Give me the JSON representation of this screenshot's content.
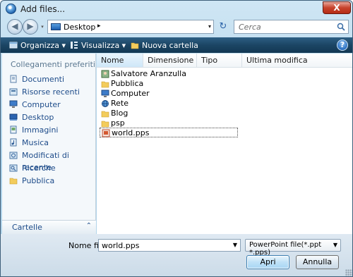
{
  "window": {
    "title": "Add files...",
    "close_label": "X"
  },
  "address": {
    "location": "Desktop",
    "separator": "▸",
    "dropdown": "▾"
  },
  "nav": {
    "back": "◀",
    "forward": "▶",
    "history": "▾",
    "refresh": "↻"
  },
  "search": {
    "placeholder": "Cerca"
  },
  "toolbar": {
    "organize": "Organizza",
    "views": "Visualizza",
    "new_folder": "Nuova cartella",
    "help": "?"
  },
  "left_pane": {
    "header": "Collegamenti preferiti",
    "items": [
      {
        "label": "Documenti",
        "icon": "documents-icon"
      },
      {
        "label": "Risorse recenti",
        "icon": "recent-icon"
      },
      {
        "label": "Computer",
        "icon": "computer-icon"
      },
      {
        "label": "Desktop",
        "icon": "desktop-icon"
      },
      {
        "label": "Immagini",
        "icon": "pictures-icon"
      },
      {
        "label": "Musica",
        "icon": "music-icon"
      },
      {
        "label": "Modificati di recente",
        "icon": "recently-changed-icon"
      },
      {
        "label": "Ricerche",
        "icon": "searches-icon"
      },
      {
        "label": "Pubblica",
        "icon": "public-folder-icon"
      }
    ],
    "folders_label": "Cartelle",
    "folders_chevron": "⌃"
  },
  "file_list": {
    "columns": [
      "Nome",
      "Dimensione",
      "Tipo",
      "Ultima modifica"
    ],
    "sort_indicator": "▲",
    "items": [
      {
        "name": "Salvatore Aranzulla",
        "icon": "user-folder-icon"
      },
      {
        "name": "Pubblica",
        "icon": "folder-icon"
      },
      {
        "name": "Computer",
        "icon": "computer-icon"
      },
      {
        "name": "Rete",
        "icon": "network-icon"
      },
      {
        "name": "Blog",
        "icon": "folder-icon"
      },
      {
        "name": "psp",
        "icon": "folder-icon"
      },
      {
        "name": "world.pps",
        "icon": "powerpoint-file-icon",
        "selected": true
      }
    ]
  },
  "footer": {
    "filename_label": "Nome file:",
    "filename_value": "world.pps",
    "filter_value": "PowerPoint file(*.ppt *.pps)",
    "open_label": "Apri",
    "cancel_label": "Annulla"
  },
  "colors": {
    "toolbar": "#1b4564",
    "link": "#1e4c8a",
    "close": "#c7432c"
  }
}
